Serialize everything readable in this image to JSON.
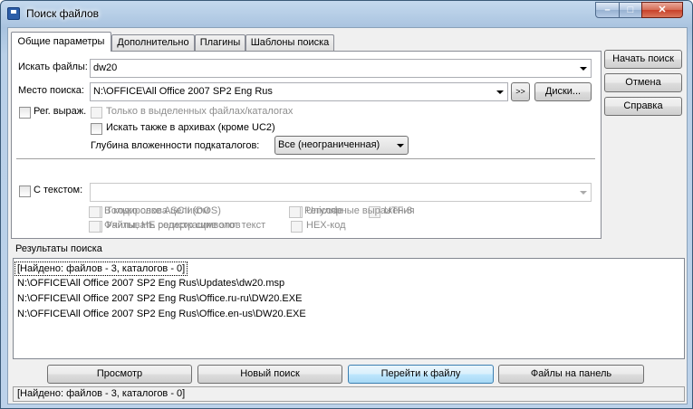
{
  "window": {
    "title": "Поиск файлов"
  },
  "tabs": [
    {
      "label": "Общие параметры"
    },
    {
      "label": "Дополнительно"
    },
    {
      "label": "Плагины"
    },
    {
      "label": "Шаблоны поиска"
    }
  ],
  "general": {
    "search_files_label": "Искать файлы:",
    "search_files_value": "dw20",
    "location_label": "Место поиска:",
    "location_value": "N:\\OFFICE\\All Office 2007 SP2 Eng Rus",
    "browse_label": ">>",
    "disks_label": "Диски...",
    "regex_label": "Рег. выраж.",
    "only_selected_label": "Только в выделенных файлах/каталогах",
    "search_archives_label": "Искать также в архивах (кроме UC2)",
    "depth_label": "Глубина вложенности подкаталогов:",
    "depth_value": "Все (неограниченная)",
    "with_text_label": "С текстом:",
    "with_text_value": "",
    "whole_words_label": "Только слова целиком",
    "case_label": "Учитывать регистр символов",
    "ascii_label": "В кодировке ASCII (DOS)",
    "not_containing_label": "Файлы, НЕ содержащие этот текст",
    "unicode_label": "Unicode",
    "utf8_label": "UTF-8",
    "hex_label": "HEX-код",
    "regex_text_label": "Регулярные выражения"
  },
  "actions": {
    "start_label": "Начать поиск",
    "cancel_label": "Отмена",
    "help_label": "Справка"
  },
  "results": {
    "group_label": "Результаты поиска",
    "items": [
      "[Найдено: файлов - 3, каталогов - 0]",
      "N:\\OFFICE\\All Office 2007 SP2 Eng Rus\\Updates\\dw20.msp",
      "N:\\OFFICE\\All Office 2007 SP2 Eng Rus\\Office.ru-ru\\DW20.EXE",
      "N:\\OFFICE\\All Office 2007 SP2 Eng Rus\\Office.en-us\\DW20.EXE"
    ]
  },
  "bottom_buttons": {
    "view_label": "Просмотр",
    "new_search_label": "Новый поиск",
    "goto_file_label": "Перейти к файлу",
    "to_panel_label": "Файлы на панель"
  },
  "status": {
    "text": "[Найдено: файлов - 3, каталогов - 0]"
  }
}
